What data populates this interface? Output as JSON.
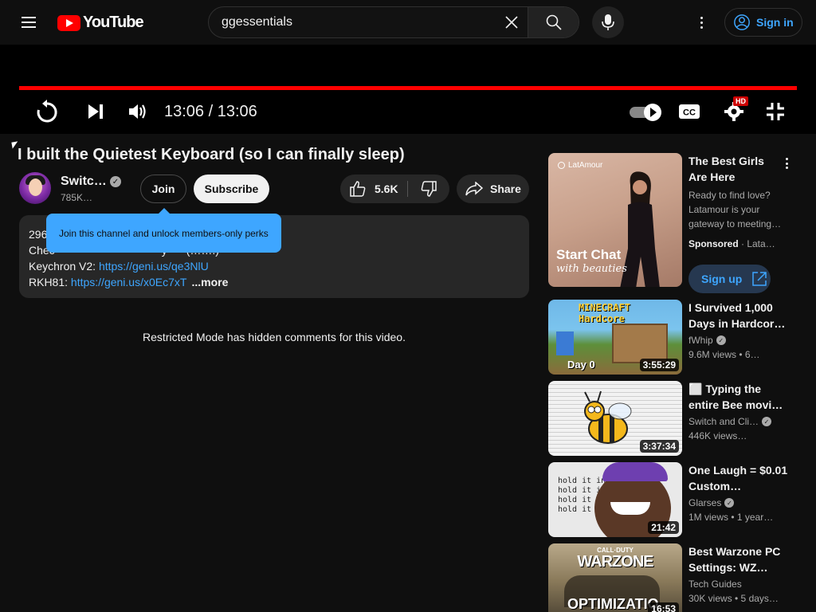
{
  "header": {
    "logo_text": "YouTube",
    "search_value": "ggessentials",
    "signin_label": "Sign in"
  },
  "player": {
    "time": "13:06 / 13:06",
    "progress": 1.0,
    "hd_badge": "HD"
  },
  "video": {
    "title": "I built the Quietest Keyboard (so I can finally sleep)",
    "channel_name": "Switc…",
    "channel_subs": "785K…",
    "join_label": "Join",
    "subscribe_label": "Subscribe",
    "likes": "5.6K",
    "share_label": "Share"
  },
  "tooltip": {
    "text": "Join this channel and unlock members-only perks"
  },
  "description": {
    "line1_prefix": "296",
    "line2_prefix": "Chec",
    "line2_suffix": "y",
    "line2_end": "(…….)",
    "keychron_label": "Keychron V2: ",
    "keychron_link": "https://geni.us/qe3NlU",
    "rkh_label": "RKH81: ",
    "rkh_link": "https://geni.us/x0Ec7xT",
    "more_label": "...more"
  },
  "restricted_text": "Restricted Mode has hidden comments for this video.",
  "ad": {
    "brand": "LatAmour",
    "thumb_line1": "Start Chat",
    "thumb_line2": "with beauties",
    "title": "The Best Girls Are Here",
    "description": "Ready to find love? Latamour is your gateway to meeting…",
    "sponsored": "Sponsored",
    "advertiser": " · Lata…",
    "cta": "Sign up"
  },
  "sidebar": [
    {
      "title": "I Survived 1,000 Days in Hardcor…",
      "channel": "fWhip",
      "verified": true,
      "meta": "9.6M views  •  6…",
      "duration": "3:55:29",
      "thumb_text": "MINECRAFT Hardcore",
      "thumb_day": "Day 0"
    },
    {
      "title": "⬜ Typing the entire Bee movi…",
      "channel": "Switch and Cli…",
      "verified": true,
      "meta": "446K views…",
      "duration": "3:37:34"
    },
    {
      "title": "One Laugh = $0.01 Custom…",
      "channel": "Glarses",
      "verified": true,
      "meta": "1M views  •  1 year…",
      "duration": "21:42",
      "thumb_text": "hold it in"
    },
    {
      "title": "Best Warzone PC Settings: WZ…",
      "channel": "Tech Guides",
      "verified": false,
      "meta": "30K views  •  5 days…",
      "duration": "16:53",
      "thumb_text": "WARZONE",
      "thumb_top": "CALL·DUTY",
      "thumb_bottom": "OPTIMIZATIO"
    }
  ]
}
